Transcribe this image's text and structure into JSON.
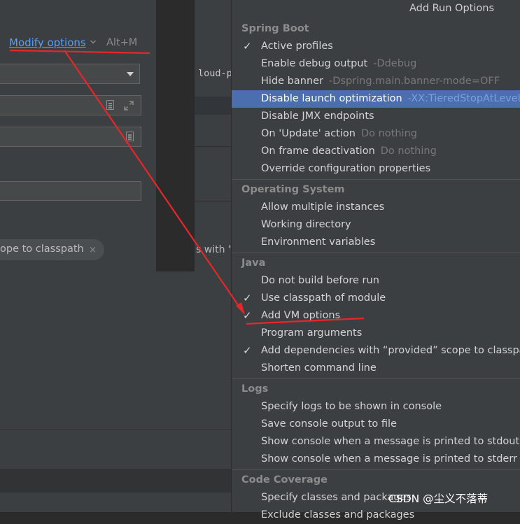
{
  "left_dialog": {
    "modify_options_label": "Modify options",
    "modify_shortcut": "Alt+M",
    "chip_label": "ope to classpath",
    "chip_close": "×"
  },
  "behind": {
    "code_text": "loud-p",
    "text_fragment": "s with \""
  },
  "popup": {
    "title": "Add Run Options",
    "check_glyph": "✓",
    "sections": [
      {
        "header": "Spring Boot",
        "items": [
          {
            "label": "Active profiles",
            "hint": "",
            "checked": true
          },
          {
            "label": "Enable debug output",
            "hint": "-Ddebug",
            "checked": false
          },
          {
            "label": "Hide banner",
            "hint": "-Dspring.main.banner-mode=OFF",
            "checked": false
          },
          {
            "label": "Disable launch optimization",
            "hint": "-XX:TieredStopAtLevel",
            "checked": false,
            "selected": true
          },
          {
            "label": "Disable JMX endpoints",
            "hint": "",
            "checked": false
          },
          {
            "label": "On 'Update' action",
            "hint": "Do nothing",
            "checked": false
          },
          {
            "label": "On frame deactivation",
            "hint": "Do nothing",
            "checked": false
          },
          {
            "label": "Override configuration properties",
            "hint": "",
            "checked": false
          }
        ]
      },
      {
        "header": "Operating System",
        "items": [
          {
            "label": "Allow multiple instances",
            "hint": "",
            "checked": false
          },
          {
            "label": "Working directory",
            "hint": "",
            "checked": false
          },
          {
            "label": "Environment variables",
            "hint": "",
            "checked": false
          }
        ]
      },
      {
        "header": "Java",
        "items": [
          {
            "label": "Do not build before run",
            "hint": "",
            "checked": false
          },
          {
            "label": "Use classpath of module",
            "hint": "",
            "checked": true
          },
          {
            "label": "Add VM options",
            "hint": "",
            "checked": true
          },
          {
            "label": "Program arguments",
            "hint": "",
            "checked": false
          },
          {
            "label": "Add dependencies with “provided” scope to classpath",
            "hint": "",
            "checked": true
          },
          {
            "label": "Shorten command line",
            "hint": "",
            "checked": false
          }
        ]
      },
      {
        "header": "Logs",
        "items": [
          {
            "label": "Specify logs to be shown in console",
            "hint": "",
            "checked": false
          },
          {
            "label": "Save console output to file",
            "hint": "",
            "checked": false
          },
          {
            "label": "Show console when a message is printed to stdout",
            "hint": "",
            "checked": false
          },
          {
            "label": "Show console when a message is printed to stderr",
            "hint": "",
            "checked": false
          }
        ]
      },
      {
        "header": "Code Coverage",
        "items": [
          {
            "label": "Specify classes and packages",
            "hint": "",
            "checked": false
          },
          {
            "label": "Exclude classes and packages",
            "hint": "",
            "checked": false
          }
        ]
      }
    ]
  },
  "watermark": "CSDN @尘义不落蒂",
  "colors": {
    "annotation_red": "#e8262a",
    "selection_blue": "#4b6eaf",
    "link_blue": "#589df6"
  }
}
